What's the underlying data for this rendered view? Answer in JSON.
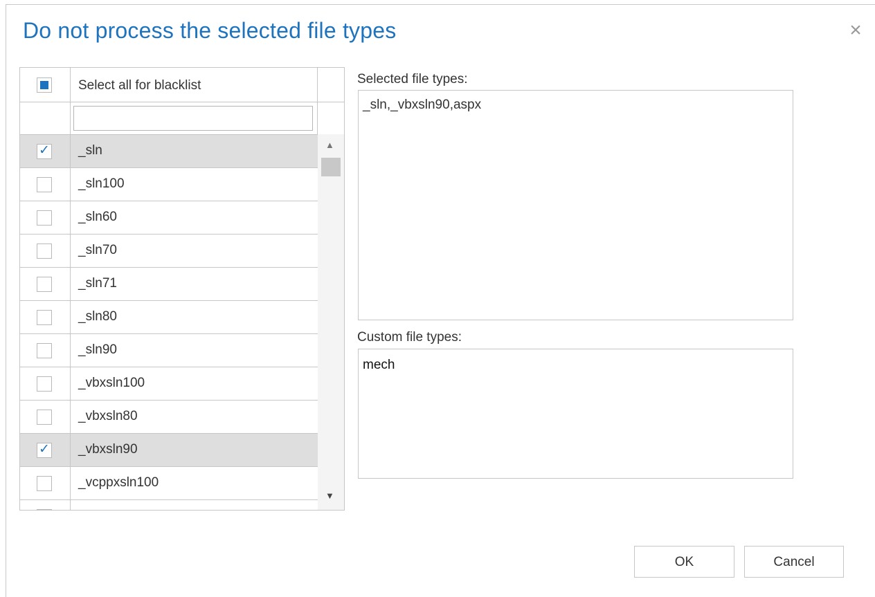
{
  "dialog": {
    "title": "Do not process the selected file types",
    "close_glyph": "×"
  },
  "grid": {
    "select_all_label": "Select all for blacklist",
    "select_all_state": "indeterminate",
    "filter_value": "",
    "rows": [
      {
        "label": "_sln",
        "checked": true
      },
      {
        "label": "_sln100",
        "checked": false
      },
      {
        "label": "_sln60",
        "checked": false
      },
      {
        "label": "_sln70",
        "checked": false
      },
      {
        "label": "_sln71",
        "checked": false
      },
      {
        "label": "_sln80",
        "checked": false
      },
      {
        "label": "_sln90",
        "checked": false
      },
      {
        "label": "_vbxsln100",
        "checked": false
      },
      {
        "label": "_vbxsln80",
        "checked": false
      },
      {
        "label": "_vbxsln90",
        "checked": true
      },
      {
        "label": "_vcppxsln100",
        "checked": false
      },
      {
        "label": "",
        "checked": false
      }
    ]
  },
  "selected": {
    "label": "Selected file types:",
    "value": "_sln,_vbxsln90,aspx"
  },
  "custom": {
    "label": "Custom file types:",
    "value": "mech"
  },
  "buttons": {
    "ok": "OK",
    "cancel": "Cancel"
  },
  "colors": {
    "title": "#1e73be",
    "check": "#1e73be",
    "selected_row": "#dedede"
  }
}
